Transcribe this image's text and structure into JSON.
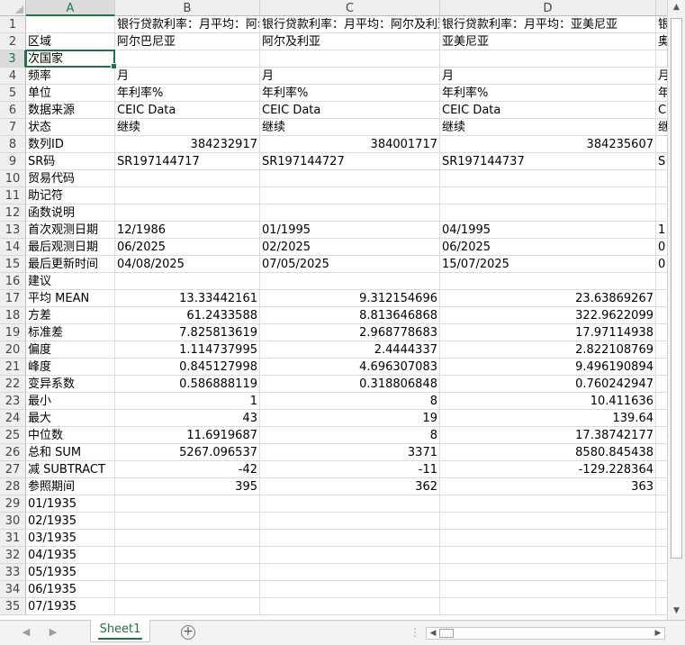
{
  "columns": [
    {
      "id": "A",
      "label": "A"
    },
    {
      "id": "B",
      "label": "B"
    },
    {
      "id": "C",
      "label": "C"
    },
    {
      "id": "D",
      "label": "D"
    },
    {
      "id": "E",
      "label": ""
    }
  ],
  "selected_cell": {
    "col": "A",
    "row": "3"
  },
  "rows": [
    {
      "n": "1",
      "cells": [
        "",
        "银行贷款利率：月平均：阿尔巴尼亚",
        "银行贷款利率：月平均：阿尔及利亚",
        "银行贷款利率：月平均：亚美尼亚",
        "银"
      ]
    },
    {
      "n": "2",
      "cells": [
        "区域",
        "阿尔巴尼亚",
        "阿尔及利亚",
        "亚美尼亚",
        "奥"
      ]
    },
    {
      "n": "3",
      "cells": [
        "次国家",
        "",
        "",
        "",
        ""
      ]
    },
    {
      "n": "4",
      "cells": [
        "频率",
        "月",
        "月",
        "月",
        "月"
      ]
    },
    {
      "n": "5",
      "cells": [
        "单位",
        "年利率%",
        "年利率%",
        "年利率%",
        "年"
      ]
    },
    {
      "n": "6",
      "cells": [
        "数据来源",
        "CEIC Data",
        "CEIC Data",
        "CEIC Data",
        "C"
      ]
    },
    {
      "n": "7",
      "cells": [
        "状态",
        "继续",
        "继续",
        "继续",
        "继"
      ]
    },
    {
      "n": "8",
      "cells": [
        "数列ID",
        "384232917",
        "384001717",
        "384235607",
        ""
      ]
    },
    {
      "n": "9",
      "cells": [
        "SR码",
        "SR197144717",
        "SR197144727",
        "SR197144737",
        "S"
      ]
    },
    {
      "n": "10",
      "cells": [
        "贸易代码",
        "",
        "",
        "",
        ""
      ]
    },
    {
      "n": "11",
      "cells": [
        "助记符",
        "",
        "",
        "",
        ""
      ]
    },
    {
      "n": "12",
      "cells": [
        "函数说明",
        "",
        "",
        "",
        ""
      ]
    },
    {
      "n": "13",
      "cells": [
        "首次观测日期",
        "12/1986",
        "01/1995",
        "04/1995",
        "1"
      ]
    },
    {
      "n": "14",
      "cells": [
        "最后观测日期",
        "06/2025",
        "02/2025",
        "06/2025",
        "0"
      ]
    },
    {
      "n": "15",
      "cells": [
        "最后更新时间",
        "04/08/2025",
        "07/05/2025",
        "15/07/2025",
        "0"
      ]
    },
    {
      "n": "16",
      "cells": [
        "建议",
        "",
        "",
        "",
        ""
      ]
    },
    {
      "n": "17",
      "cells": [
        "平均 MEAN",
        "13.33442161",
        "9.312154696",
        "23.63869267",
        ""
      ]
    },
    {
      "n": "18",
      "cells": [
        "方差",
        "61.2433588",
        "8.813646868",
        "322.9622099",
        ""
      ]
    },
    {
      "n": "19",
      "cells": [
        "标准差",
        "7.825813619",
        "2.968778683",
        "17.97114938",
        ""
      ]
    },
    {
      "n": "20",
      "cells": [
        "偏度",
        "1.114737995",
        "2.4444337",
        "2.822108769",
        ""
      ]
    },
    {
      "n": "21",
      "cells": [
        "峰度",
        "0.845127998",
        "4.696307083",
        "9.496190894",
        ""
      ]
    },
    {
      "n": "22",
      "cells": [
        "变异系数",
        "0.586888119",
        "0.318806848",
        "0.760242947",
        ""
      ]
    },
    {
      "n": "23",
      "cells": [
        "最小",
        "1",
        "8",
        "10.411636",
        ""
      ]
    },
    {
      "n": "24",
      "cells": [
        "最大",
        "43",
        "19",
        "139.64",
        ""
      ]
    },
    {
      "n": "25",
      "cells": [
        "中位数",
        "11.6919687",
        "8",
        "17.38742177",
        ""
      ]
    },
    {
      "n": "26",
      "cells": [
        "总和 SUM",
        "5267.096537",
        "3371",
        "8580.845438",
        ""
      ]
    },
    {
      "n": "27",
      "cells": [
        "减 SUBTRACT",
        "-42",
        "-11",
        "-129.228364",
        ""
      ]
    },
    {
      "n": "28",
      "cells": [
        "参照期间",
        "395",
        "362",
        "363",
        ""
      ]
    },
    {
      "n": "29",
      "cells": [
        "01/1935",
        "",
        "",
        "",
        ""
      ]
    },
    {
      "n": "30",
      "cells": [
        "02/1935",
        "",
        "",
        "",
        ""
      ]
    },
    {
      "n": "31",
      "cells": [
        "03/1935",
        "",
        "",
        "",
        ""
      ]
    },
    {
      "n": "32",
      "cells": [
        "04/1935",
        "",
        "",
        "",
        ""
      ]
    },
    {
      "n": "33",
      "cells": [
        "05/1935",
        "",
        "",
        "",
        ""
      ]
    },
    {
      "n": "34",
      "cells": [
        "06/1935",
        "",
        "",
        "",
        ""
      ]
    },
    {
      "n": "35",
      "cells": [
        "07/1935",
        "",
        "",
        "",
        ""
      ]
    }
  ],
  "numeric_rows": [
    "8",
    "17",
    "18",
    "19",
    "20",
    "21",
    "22",
    "23",
    "24",
    "25",
    "26",
    "27",
    "28"
  ],
  "sheet_tabs": [
    {
      "label": "Sheet1",
      "active": true
    }
  ],
  "icons": {
    "prev_sheet": "chevron-left-icon",
    "next_sheet": "chevron-right-icon",
    "add_sheet": "plus-circle-icon"
  },
  "colors": {
    "accent": "#217346"
  }
}
